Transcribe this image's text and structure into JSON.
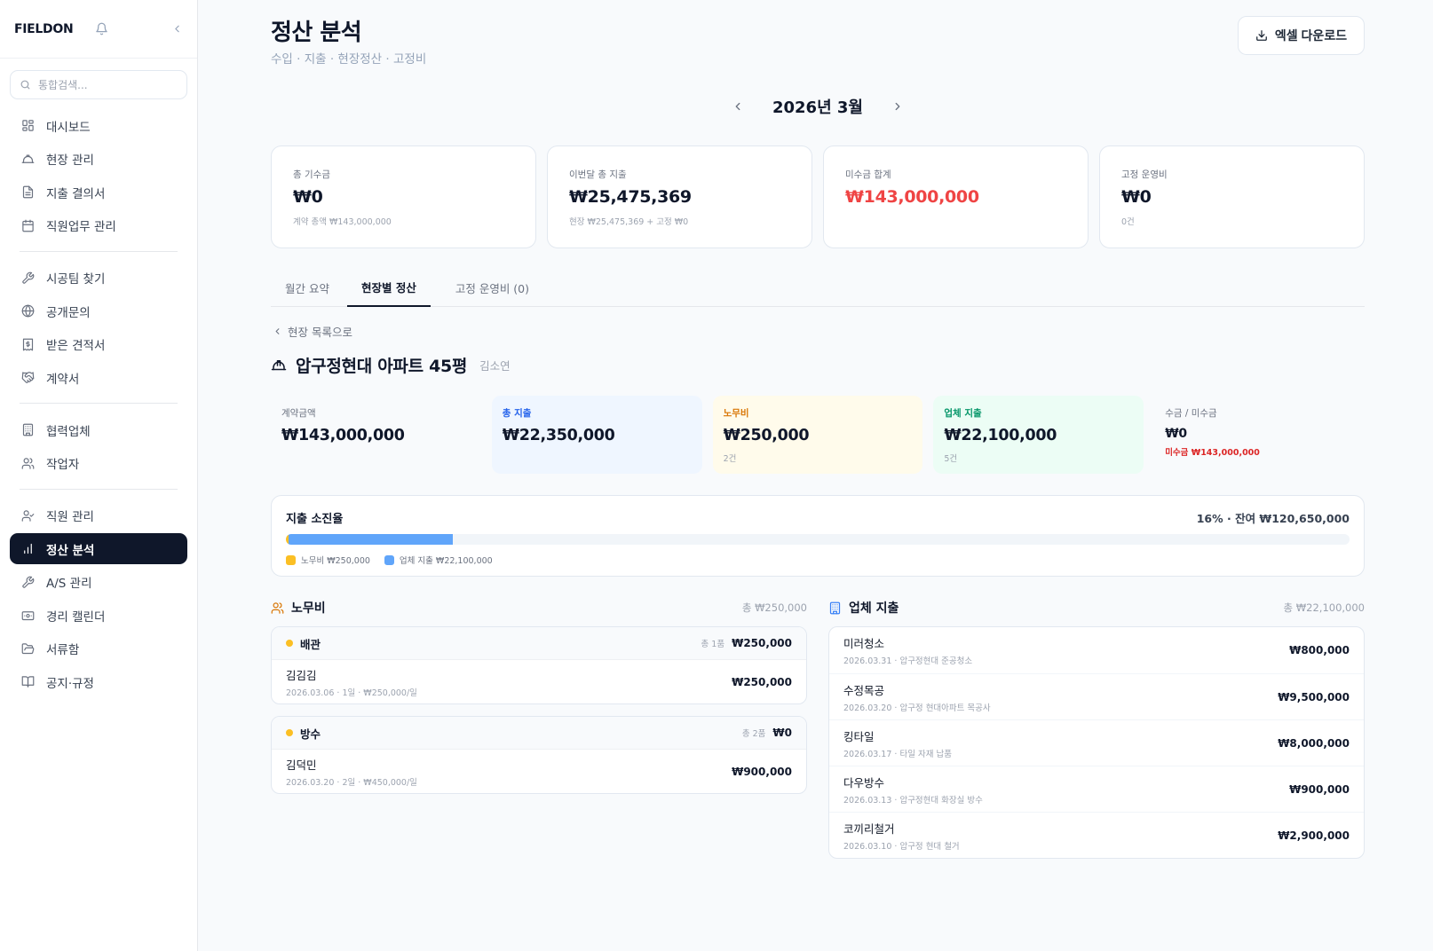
{
  "sidebar": {
    "brand": "FIELDON",
    "search_placeholder": "통합검색...",
    "groups": [
      [
        {
          "label": "대시보드",
          "icon": "dashboard-icon"
        },
        {
          "label": "현장 관리",
          "icon": "hardhat-icon"
        },
        {
          "label": "지출 결의서",
          "icon": "document-icon"
        },
        {
          "label": "직원업무 관리",
          "icon": "calendar-icon"
        }
      ],
      [
        {
          "label": "시공팀 찾기",
          "icon": "wrench-icon"
        },
        {
          "label": "공개문의",
          "icon": "globe-icon"
        },
        {
          "label": "받은 견적서",
          "icon": "receipt-icon"
        },
        {
          "label": "계약서",
          "icon": "handshake-icon"
        }
      ],
      [
        {
          "label": "협력업체",
          "icon": "building-icon"
        },
        {
          "label": "작업자",
          "icon": "users-icon"
        }
      ],
      [
        {
          "label": "직원 관리",
          "icon": "user-check-icon"
        },
        {
          "label": "정산 분석",
          "icon": "bar-chart-icon",
          "active": true
        },
        {
          "label": "A/S 관리",
          "icon": "wrench-icon"
        },
        {
          "label": "경리 캘린더",
          "icon": "wallet-icon"
        },
        {
          "label": "서류함",
          "icon": "folder-icon"
        },
        {
          "label": "공지·규정",
          "icon": "book-icon"
        }
      ]
    ]
  },
  "header": {
    "title": "정산 분석",
    "subtitle": "수입 · 지출 · 현장정산 · 고정비",
    "excel_button": "엑셀 다운로드",
    "month": "2026년 3월"
  },
  "stats": [
    {
      "label": "총 기수금",
      "value": "₩0",
      "note": "계약 총액 ₩143,000,000",
      "tone": "normal"
    },
    {
      "label": "이번달 총 지출",
      "value": "₩25,475,369",
      "note": "현장 ₩25,475,369 + 고정 ₩0",
      "tone": "normal"
    },
    {
      "label": "미수금 합계",
      "value": "₩143,000,000",
      "note": "",
      "tone": "red"
    },
    {
      "label": "고정 운영비",
      "value": "₩0",
      "note": "0건",
      "tone": "normal"
    }
  ],
  "tabs": [
    {
      "label": "월간 요약",
      "active": false
    },
    {
      "label": "현장별 정산",
      "active": true
    },
    {
      "label": "고정 운영비 (0)",
      "active": false
    }
  ],
  "site": {
    "back_label": "현장 목록으로",
    "name": "압구정현대 아파트 45평",
    "manager": "김소연"
  },
  "kpis": [
    {
      "label": "계약금액",
      "value": "₩143,000,000",
      "note": "",
      "style": "plain"
    },
    {
      "label": "총 지출",
      "value": "₩22,350,000",
      "note": "",
      "style": "blue"
    },
    {
      "label": "노무비",
      "value": "₩250,000",
      "note": "2건",
      "style": "yellow"
    },
    {
      "label": "업체 지출",
      "value": "₩22,100,000",
      "note": "5건",
      "style": "green"
    },
    {
      "label": "수금 / 미수금",
      "value": "₩0",
      "note": "미수금 ₩143,000,000",
      "style": "receivable"
    }
  ],
  "burn": {
    "title": "지출 소진율",
    "summary": "16% · 잔여 ₩120,650,000",
    "labor_fraction": 0.0027,
    "vendor_fraction": 0.1543,
    "legend_labor": "노무비 ₩250,000",
    "legend_vendor": "업체 지출 ₩22,100,000",
    "colors": {
      "labor": "#fbbf24",
      "vendor": "#60a5fa"
    }
  },
  "labor": {
    "title": "노무비",
    "total": "총 ₩250,000",
    "groups": [
      {
        "name": "배관",
        "meta": "총 1품",
        "amount": "₩250,000",
        "rows": [
          {
            "name": "김김김",
            "sub": "2026.03.06 · 1일 · ₩250,000/일",
            "amount": "₩250,000"
          }
        ]
      },
      {
        "name": "방수",
        "meta": "총 2품",
        "amount": "₩0",
        "rows": [
          {
            "name": "김덕민",
            "sub": "2026.03.20 · 2일 · ₩450,000/일",
            "amount": "₩900,000"
          }
        ]
      }
    ]
  },
  "vendor": {
    "title": "업체 지출",
    "total": "총 ₩22,100,000",
    "rows": [
      {
        "name": "미러청소",
        "sub": "2026.03.31 · 압구정현대 준공청소",
        "amount": "₩800,000"
      },
      {
        "name": "수정목공",
        "sub": "2026.03.20 · 압구정 현대아파트 목공사",
        "amount": "₩9,500,000"
      },
      {
        "name": "킹타일",
        "sub": "2026.03.17 · 타일 자재 납품",
        "amount": "₩8,000,000"
      },
      {
        "name": "다우방수",
        "sub": "2026.03.13 · 압구정현대 화장실 방수",
        "amount": "₩900,000"
      },
      {
        "name": "코끼리철거",
        "sub": "2026.03.10 · 압구정 현대 철거",
        "amount": "₩2,900,000"
      }
    ]
  }
}
